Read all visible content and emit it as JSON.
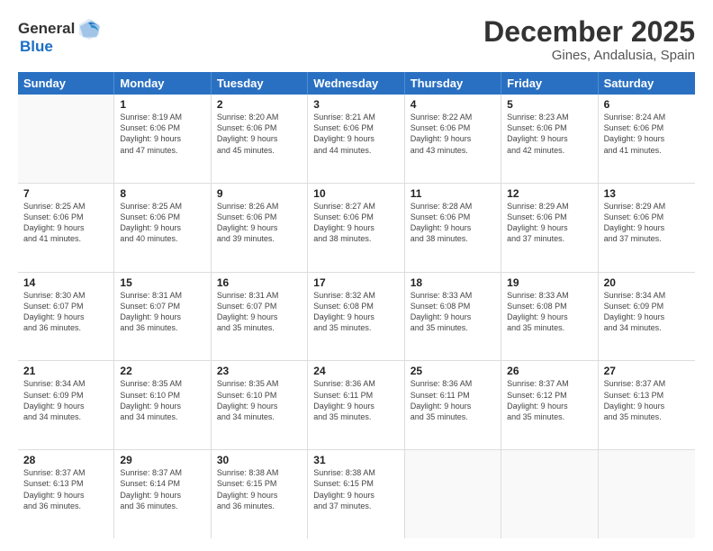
{
  "logo": {
    "general": "General",
    "blue": "Blue"
  },
  "title": "December 2025",
  "subtitle": "Gines, Andalusia, Spain",
  "days_of_week": [
    "Sunday",
    "Monday",
    "Tuesday",
    "Wednesday",
    "Thursday",
    "Friday",
    "Saturday"
  ],
  "weeks": [
    [
      {
        "day": "",
        "lines": []
      },
      {
        "day": "1",
        "lines": [
          "Sunrise: 8:19 AM",
          "Sunset: 6:06 PM",
          "Daylight: 9 hours",
          "and 47 minutes."
        ]
      },
      {
        "day": "2",
        "lines": [
          "Sunrise: 8:20 AM",
          "Sunset: 6:06 PM",
          "Daylight: 9 hours",
          "and 45 minutes."
        ]
      },
      {
        "day": "3",
        "lines": [
          "Sunrise: 8:21 AM",
          "Sunset: 6:06 PM",
          "Daylight: 9 hours",
          "and 44 minutes."
        ]
      },
      {
        "day": "4",
        "lines": [
          "Sunrise: 8:22 AM",
          "Sunset: 6:06 PM",
          "Daylight: 9 hours",
          "and 43 minutes."
        ]
      },
      {
        "day": "5",
        "lines": [
          "Sunrise: 8:23 AM",
          "Sunset: 6:06 PM",
          "Daylight: 9 hours",
          "and 42 minutes."
        ]
      },
      {
        "day": "6",
        "lines": [
          "Sunrise: 8:24 AM",
          "Sunset: 6:06 PM",
          "Daylight: 9 hours",
          "and 41 minutes."
        ]
      }
    ],
    [
      {
        "day": "7",
        "lines": [
          "Sunrise: 8:25 AM",
          "Sunset: 6:06 PM",
          "Daylight: 9 hours",
          "and 41 minutes."
        ]
      },
      {
        "day": "8",
        "lines": [
          "Sunrise: 8:25 AM",
          "Sunset: 6:06 PM",
          "Daylight: 9 hours",
          "and 40 minutes."
        ]
      },
      {
        "day": "9",
        "lines": [
          "Sunrise: 8:26 AM",
          "Sunset: 6:06 PM",
          "Daylight: 9 hours",
          "and 39 minutes."
        ]
      },
      {
        "day": "10",
        "lines": [
          "Sunrise: 8:27 AM",
          "Sunset: 6:06 PM",
          "Daylight: 9 hours",
          "and 38 minutes."
        ]
      },
      {
        "day": "11",
        "lines": [
          "Sunrise: 8:28 AM",
          "Sunset: 6:06 PM",
          "Daylight: 9 hours",
          "and 38 minutes."
        ]
      },
      {
        "day": "12",
        "lines": [
          "Sunrise: 8:29 AM",
          "Sunset: 6:06 PM",
          "Daylight: 9 hours",
          "and 37 minutes."
        ]
      },
      {
        "day": "13",
        "lines": [
          "Sunrise: 8:29 AM",
          "Sunset: 6:06 PM",
          "Daylight: 9 hours",
          "and 37 minutes."
        ]
      }
    ],
    [
      {
        "day": "14",
        "lines": [
          "Sunrise: 8:30 AM",
          "Sunset: 6:07 PM",
          "Daylight: 9 hours",
          "and 36 minutes."
        ]
      },
      {
        "day": "15",
        "lines": [
          "Sunrise: 8:31 AM",
          "Sunset: 6:07 PM",
          "Daylight: 9 hours",
          "and 36 minutes."
        ]
      },
      {
        "day": "16",
        "lines": [
          "Sunrise: 8:31 AM",
          "Sunset: 6:07 PM",
          "Daylight: 9 hours",
          "and 35 minutes."
        ]
      },
      {
        "day": "17",
        "lines": [
          "Sunrise: 8:32 AM",
          "Sunset: 6:08 PM",
          "Daylight: 9 hours",
          "and 35 minutes."
        ]
      },
      {
        "day": "18",
        "lines": [
          "Sunrise: 8:33 AM",
          "Sunset: 6:08 PM",
          "Daylight: 9 hours",
          "and 35 minutes."
        ]
      },
      {
        "day": "19",
        "lines": [
          "Sunrise: 8:33 AM",
          "Sunset: 6:08 PM",
          "Daylight: 9 hours",
          "and 35 minutes."
        ]
      },
      {
        "day": "20",
        "lines": [
          "Sunrise: 8:34 AM",
          "Sunset: 6:09 PM",
          "Daylight: 9 hours",
          "and 34 minutes."
        ]
      }
    ],
    [
      {
        "day": "21",
        "lines": [
          "Sunrise: 8:34 AM",
          "Sunset: 6:09 PM",
          "Daylight: 9 hours",
          "and 34 minutes."
        ]
      },
      {
        "day": "22",
        "lines": [
          "Sunrise: 8:35 AM",
          "Sunset: 6:10 PM",
          "Daylight: 9 hours",
          "and 34 minutes."
        ]
      },
      {
        "day": "23",
        "lines": [
          "Sunrise: 8:35 AM",
          "Sunset: 6:10 PM",
          "Daylight: 9 hours",
          "and 34 minutes."
        ]
      },
      {
        "day": "24",
        "lines": [
          "Sunrise: 8:36 AM",
          "Sunset: 6:11 PM",
          "Daylight: 9 hours",
          "and 35 minutes."
        ]
      },
      {
        "day": "25",
        "lines": [
          "Sunrise: 8:36 AM",
          "Sunset: 6:11 PM",
          "Daylight: 9 hours",
          "and 35 minutes."
        ]
      },
      {
        "day": "26",
        "lines": [
          "Sunrise: 8:37 AM",
          "Sunset: 6:12 PM",
          "Daylight: 9 hours",
          "and 35 minutes."
        ]
      },
      {
        "day": "27",
        "lines": [
          "Sunrise: 8:37 AM",
          "Sunset: 6:13 PM",
          "Daylight: 9 hours",
          "and 35 minutes."
        ]
      }
    ],
    [
      {
        "day": "28",
        "lines": [
          "Sunrise: 8:37 AM",
          "Sunset: 6:13 PM",
          "Daylight: 9 hours",
          "and 36 minutes."
        ]
      },
      {
        "day": "29",
        "lines": [
          "Sunrise: 8:37 AM",
          "Sunset: 6:14 PM",
          "Daylight: 9 hours",
          "and 36 minutes."
        ]
      },
      {
        "day": "30",
        "lines": [
          "Sunrise: 8:38 AM",
          "Sunset: 6:15 PM",
          "Daylight: 9 hours",
          "and 36 minutes."
        ]
      },
      {
        "day": "31",
        "lines": [
          "Sunrise: 8:38 AM",
          "Sunset: 6:15 PM",
          "Daylight: 9 hours",
          "and 37 minutes."
        ]
      },
      {
        "day": "",
        "lines": []
      },
      {
        "day": "",
        "lines": []
      },
      {
        "day": "",
        "lines": []
      }
    ]
  ]
}
